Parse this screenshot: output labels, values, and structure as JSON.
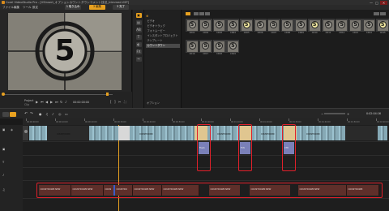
{
  "window": {
    "title": "Corel VideoStudio Pro - [VSInsert_オプションカウントダウンコメント技法_trimmed.VSP]",
    "min": "—",
    "max": "□",
    "close": "✕"
  },
  "menu": [
    "ファイル",
    "編集",
    "ツール",
    "設定"
  ],
  "steps": [
    "1 取り込み",
    "2 編集",
    "3 完了"
  ],
  "preview": {
    "countdown_digit": "5",
    "project_label": "Project",
    "clip_label": "Clip",
    "timecode": "00:00:00:00"
  },
  "library": {
    "nav": [
      "ビデオ",
      "ビデオトラック",
      "フォトムービー",
      "インスタントプロジェクト",
      "テンプレート",
      "カウントダウン"
    ],
    "nav_selected": 5,
    "thumbs": [
      {
        "digit": "5",
        "cap": "CD01"
      },
      {
        "digit": "5",
        "cap": "CD02"
      },
      {
        "digit": "5",
        "cap": "CD03"
      },
      {
        "digit": "5",
        "cap": "CD04"
      },
      {
        "digit": "5",
        "cap": "CD05"
      },
      {
        "digit": "5",
        "cap": "CD06"
      },
      {
        "digit": "5",
        "cap": "CD07"
      },
      {
        "digit": "5",
        "cap": "CD08"
      },
      {
        "digit": "5",
        "cap": "CD09"
      },
      {
        "digit": "5",
        "cap": "CD10"
      },
      {
        "digit": "5",
        "cap": "CD11"
      },
      {
        "digit": "5",
        "cap": "CD12"
      },
      {
        "digit": "5",
        "cap": "CD13"
      },
      {
        "digit": "5",
        "cap": "CD14"
      },
      {
        "digit": "5",
        "cap": "CD15"
      },
      {
        "digit": "5",
        "cap": "CD16"
      },
      {
        "digit": "5",
        "cap": "CD17"
      },
      {
        "digit": "5",
        "cap": "CD18"
      },
      {
        "digit": "5",
        "cap": "CD19"
      }
    ],
    "options_label": "オプション"
  },
  "timeline": {
    "duration": "0:02:04:16",
    "ruler_labels": [
      "00:00:00:00",
      "00:00:10:00",
      "00:00:20:00",
      "00:00:30:00",
      "00:00:40:00",
      "00:00:50:00",
      "00:01:00:00",
      "00:01:10:00",
      "00:01:20:00",
      "00:01:30:00",
      "00:01:40:00",
      "00:01:50:00",
      "00:02:00:00"
    ],
    "video_labels": [
      "COUNTDOWN",
      "COUNTDOWN",
      "COUNTDOWN",
      "COUNTDOWN",
      "COUNTDOWN"
    ],
    "overlay_labels": [
      "Flash",
      "FOV",
      "CTR"
    ],
    "audio_labels": [
      "COUNTDOWN NEW",
      "COUNTDOWN NEW",
      "COUN",
      "COUNTDO",
      "COUNTDOWN NEW",
      "COUNTDOWN NEW",
      "COUNTDOWN NEW",
      "COUNTDOWN NEW",
      "COUNTDOWN NEW",
      "COUNTDOWN"
    ]
  },
  "colors": {
    "accent": "#e8a120",
    "highlight": "#e0202a",
    "video_clip": "#86a9b5",
    "overlay_clip": "#7a80b8",
    "audio_clip": "#5e2f2a"
  }
}
